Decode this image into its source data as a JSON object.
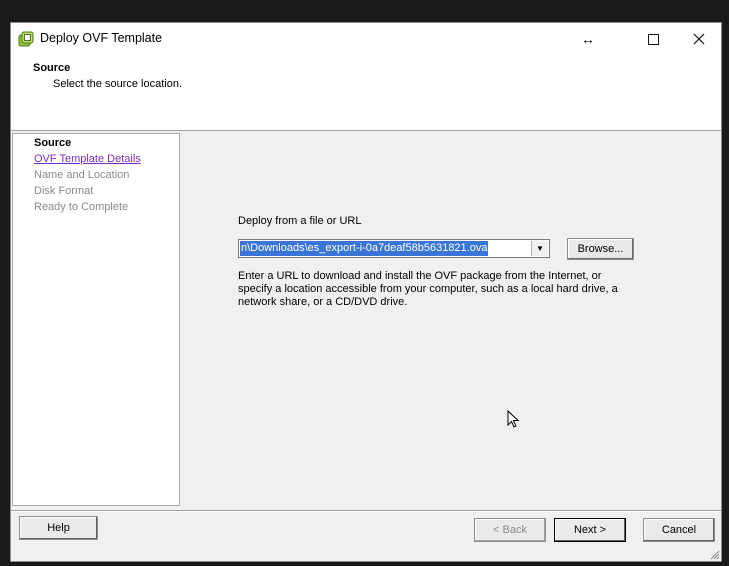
{
  "window": {
    "title": "Deploy OVF Template",
    "controls": {
      "resize": "↔",
      "maximize": "☐",
      "close": "✕"
    }
  },
  "header": {
    "title": "Source",
    "subtitle": "Select the source location."
  },
  "steps": [
    {
      "label": "Source",
      "state": "current"
    },
    {
      "label": "OVF Template Details",
      "state": "link"
    },
    {
      "label": "Name and Location",
      "state": "disabled"
    },
    {
      "label": "Disk Format",
      "state": "disabled"
    },
    {
      "label": "Ready to Complete",
      "state": "disabled"
    }
  ],
  "main": {
    "deploy_label": "Deploy from a file or URL",
    "path_value": "n\\Downloads\\es_export-i-0a7deaf58b5631821.ova",
    "browse_label": "Browse...",
    "help_text": "Enter a URL to download and install the OVF package from the Internet, or specify a location accessible from your computer, such as a local hard drive, a network share, or a CD/DVD drive."
  },
  "footer": {
    "help_label": "Help",
    "back_label": "< Back",
    "next_label": "Next >",
    "cancel_label": "Cancel"
  },
  "colors": {
    "selection": "#3875d7",
    "link": "#7a2ebf",
    "disabled_text": "#8a8a8a"
  }
}
